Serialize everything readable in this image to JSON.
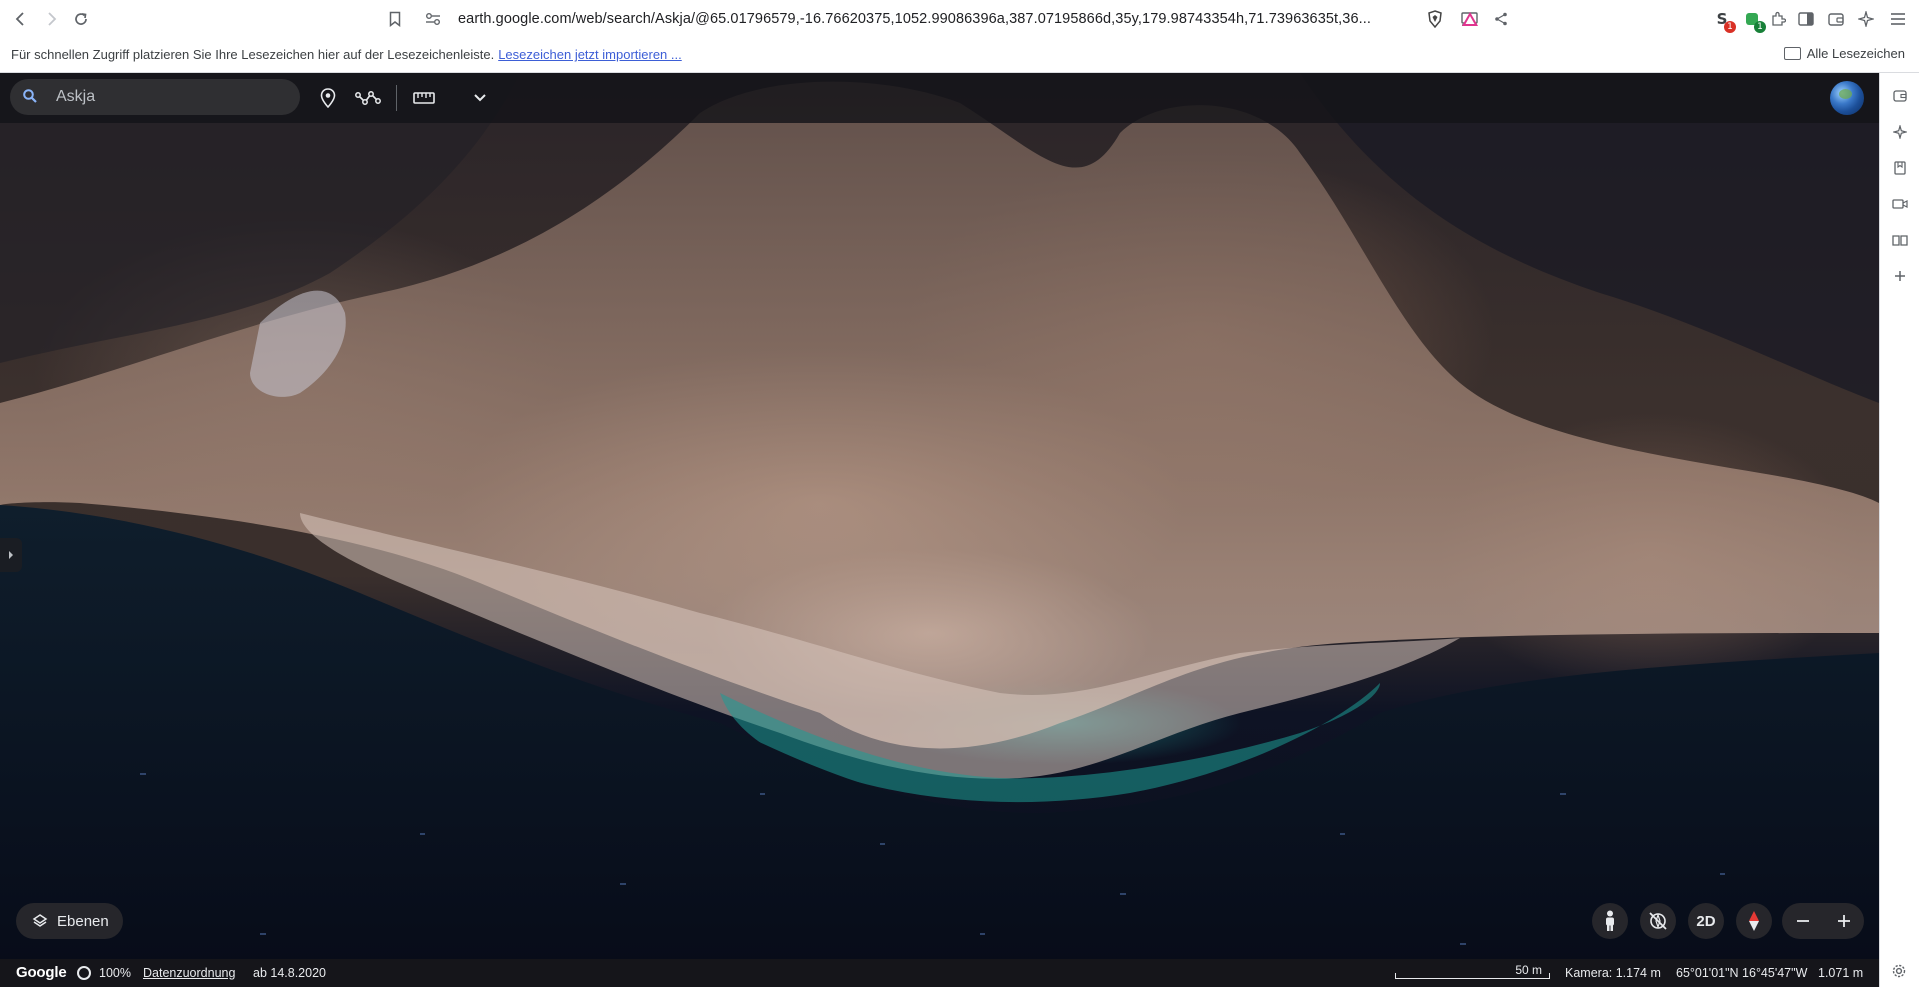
{
  "browser": {
    "url": "earth.google.com/web/search/Askja/@65.01796579,-16.76620375,1052.99086396a,387.07195866d,35y,179.98743354h,71.73963635t,36...",
    "bookmarks_hint": "Für schnellen Zugriff platzieren Sie Ihre Lesezeichen hier auf der Lesezeichenleiste.",
    "bookmarks_import_link": "Lesezeichen jetzt importieren ...",
    "all_bookmarks": "Alle Lesezeichen",
    "extension_badges": [
      "1",
      "1"
    ]
  },
  "earth": {
    "search": {
      "value": "Askja",
      "placeholder": "Askja"
    },
    "layers_label": "Ebenen",
    "view_2d_label": "2D",
    "status": {
      "logo": "Google",
      "load_percent": "100%",
      "attribution": "Datenzuordnung",
      "imagery_date": "ab 14.8.2020",
      "scale_label": "50 m",
      "camera": "Kamera: 1.174 m",
      "coordinates": "65°01'01\"N 16°45'47\"W",
      "elevation": "1.071 m"
    }
  },
  "icons": {
    "back": "back-arrow-icon",
    "forward": "forward-arrow-icon",
    "reload": "reload-icon",
    "bookmark": "bookmark-icon",
    "site_settings": "site-settings-icon",
    "cast": "cast-icon",
    "share": "share-icon",
    "brave": "brave-shield-icon",
    "rewards": "brave-rewards-icon",
    "colors": {
      "accent_link": "#3d5ed6",
      "compass_needle": "#e53935",
      "extension_badge_red": "#d93025",
      "extension_badge_green": "#188038"
    }
  }
}
